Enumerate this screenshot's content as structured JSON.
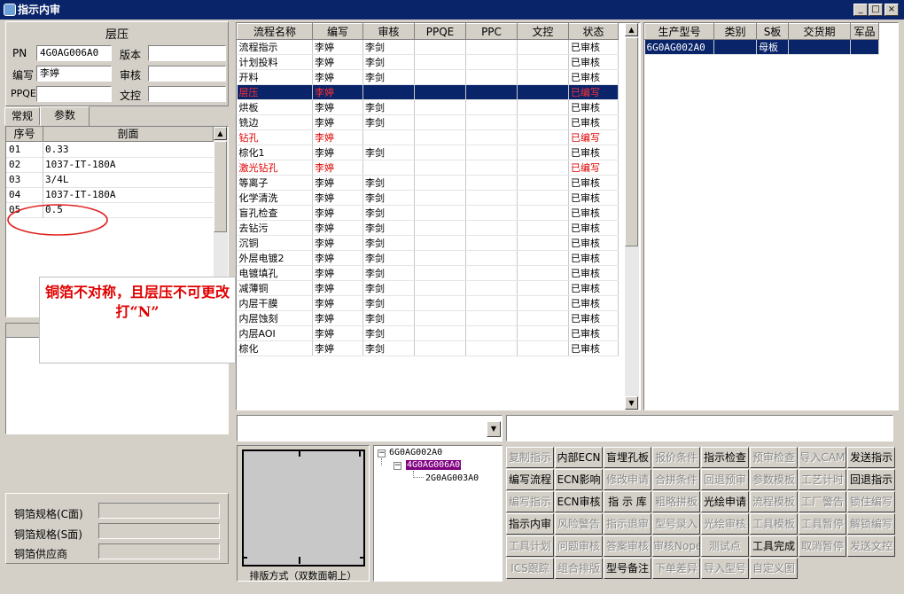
{
  "window": {
    "title": "指示内审",
    "min": "_",
    "max": "□",
    "close": "×"
  },
  "left": {
    "section_title": "层压",
    "pn_label": "PN",
    "pn_value": "4G0AG006A0",
    "version_label": "版本",
    "version_value": "",
    "writer_label": "编写",
    "writer_value": "李婷",
    "review_label": "审核",
    "review_value": "",
    "ppqe_label": "PPQE",
    "ppqe_value": "",
    "doc_label": "文控",
    "doc_value": "",
    "tabs": [
      "常规",
      "参数"
    ],
    "param_headers": [
      "序号",
      "剖面"
    ],
    "params": [
      {
        "no": "01",
        "val": "0.33"
      },
      {
        "no": "02",
        "val": "1037-IT-180A"
      },
      {
        "no": "03",
        "val": "3/4L"
      },
      {
        "no": "04",
        "val": "1037-IT-180A"
      },
      {
        "no": "05",
        "val": "0.5"
      }
    ],
    "annotation": "铜箔不对称，且层压不可更改打“N”",
    "copper_c_label": "铜箔规格(C面)",
    "copper_c_value": "",
    "copper_s_label": "铜箔规格(S面)",
    "copper_s_value": "",
    "copper_vendor_label": "铜箔供应商",
    "copper_vendor_value": ""
  },
  "process": {
    "headers": [
      "流程名称",
      "编写",
      "审核",
      "PPQE",
      "PPC",
      "文控",
      "状态"
    ],
    "rows": [
      {
        "name": "流程指示",
        "writer": "李婷",
        "reviewer": "李剑",
        "ppqe": "",
        "ppc": "",
        "doc": "",
        "status": "已审核",
        "style": ""
      },
      {
        "name": "计划投料",
        "writer": "李婷",
        "reviewer": "李剑",
        "ppqe": "",
        "ppc": "",
        "doc": "",
        "status": "已审核",
        "style": ""
      },
      {
        "name": "开料",
        "writer": "李婷",
        "reviewer": "李剑",
        "ppqe": "",
        "ppc": "",
        "doc": "",
        "status": "已审核",
        "style": ""
      },
      {
        "name": "层压",
        "writer": "李婷",
        "reviewer": "",
        "ppqe": "",
        "ppc": "",
        "doc": "",
        "status": "已编写",
        "style": "sel"
      },
      {
        "name": "烘板",
        "writer": "李婷",
        "reviewer": "李剑",
        "ppqe": "",
        "ppc": "",
        "doc": "",
        "status": "已审核",
        "style": ""
      },
      {
        "name": "铣边",
        "writer": "李婷",
        "reviewer": "李剑",
        "ppqe": "",
        "ppc": "",
        "doc": "",
        "status": "已审核",
        "style": ""
      },
      {
        "name": "钻孔",
        "writer": "李婷",
        "reviewer": "",
        "ppqe": "",
        "ppc": "",
        "doc": "",
        "status": "已编写",
        "style": "red"
      },
      {
        "name": "棕化1",
        "writer": "李婷",
        "reviewer": "李剑",
        "ppqe": "",
        "ppc": "",
        "doc": "",
        "status": "已审核",
        "style": ""
      },
      {
        "name": "激光钻孔",
        "writer": "李婷",
        "reviewer": "",
        "ppqe": "",
        "ppc": "",
        "doc": "",
        "status": "已编写",
        "style": "red"
      },
      {
        "name": "等离子",
        "writer": "李婷",
        "reviewer": "李剑",
        "ppqe": "",
        "ppc": "",
        "doc": "",
        "status": "已审核",
        "style": ""
      },
      {
        "name": "化学清洗",
        "writer": "李婷",
        "reviewer": "李剑",
        "ppqe": "",
        "ppc": "",
        "doc": "",
        "status": "已审核",
        "style": ""
      },
      {
        "name": "盲孔检查",
        "writer": "李婷",
        "reviewer": "李剑",
        "ppqe": "",
        "ppc": "",
        "doc": "",
        "status": "已审核",
        "style": ""
      },
      {
        "name": "去钻污",
        "writer": "李婷",
        "reviewer": "李剑",
        "ppqe": "",
        "ppc": "",
        "doc": "",
        "status": "已审核",
        "style": ""
      },
      {
        "name": "沉铜",
        "writer": "李婷",
        "reviewer": "李剑",
        "ppqe": "",
        "ppc": "",
        "doc": "",
        "status": "已审核",
        "style": ""
      },
      {
        "name": "外层电镀2",
        "writer": "李婷",
        "reviewer": "李剑",
        "ppqe": "",
        "ppc": "",
        "doc": "",
        "status": "已审核",
        "style": ""
      },
      {
        "name": "电镀填孔",
        "writer": "李婷",
        "reviewer": "李剑",
        "ppqe": "",
        "ppc": "",
        "doc": "",
        "status": "已审核",
        "style": ""
      },
      {
        "name": "减薄铜",
        "writer": "李婷",
        "reviewer": "李剑",
        "ppqe": "",
        "ppc": "",
        "doc": "",
        "status": "已审核",
        "style": ""
      },
      {
        "name": "内层干膜",
        "writer": "李婷",
        "reviewer": "李剑",
        "ppqe": "",
        "ppc": "",
        "doc": "",
        "status": "已审核",
        "style": ""
      },
      {
        "name": "内层蚀刻",
        "writer": "李婷",
        "reviewer": "李剑",
        "ppqe": "",
        "ppc": "",
        "doc": "",
        "status": "已审核",
        "style": ""
      },
      {
        "name": "内层AOI",
        "writer": "李婷",
        "reviewer": "李剑",
        "ppqe": "",
        "ppc": "",
        "doc": "",
        "status": "已审核",
        "style": ""
      },
      {
        "name": "棕化",
        "writer": "李婷",
        "reviewer": "李剑",
        "ppqe": "",
        "ppc": "",
        "doc": "",
        "status": "已审核",
        "style": ""
      }
    ]
  },
  "product": {
    "headers": [
      "生产型号",
      "类别",
      "S板",
      "交货期",
      "军品"
    ],
    "rows": [
      {
        "model": "6G0AG002A0",
        "cat": "",
        "sboard": "母板",
        "due": "",
        "mil": ""
      }
    ]
  },
  "combo_value": "",
  "preview_caption": "排版方式（双数面朝上）",
  "tree": {
    "root": "6G0AG002A0",
    "child": "4G0AG006A0",
    "leaf": "2G0AG003A0"
  },
  "buttons": [
    [
      {
        "t": "复制指示",
        "e": false
      },
      {
        "t": "内部ECN",
        "e": true
      },
      {
        "t": "盲埋孔板",
        "e": true
      },
      {
        "t": "报价条件",
        "e": false
      },
      {
        "t": "指示检查",
        "e": true
      },
      {
        "t": "预审检查",
        "e": false
      },
      {
        "t": "导入CAM",
        "e": false
      },
      {
        "t": "发送指示",
        "e": true
      }
    ],
    [
      {
        "t": "编写流程",
        "e": true
      },
      {
        "t": "ECN影响",
        "e": true
      },
      {
        "t": "修改申请",
        "e": false
      },
      {
        "t": "合拼条件",
        "e": false
      },
      {
        "t": "回退预审",
        "e": false
      },
      {
        "t": "参数模板",
        "e": false
      },
      {
        "t": "工艺计时",
        "e": false
      },
      {
        "t": "回退指示",
        "e": true
      }
    ],
    [
      {
        "t": "编写指示",
        "e": false
      },
      {
        "t": "ECN审核",
        "e": true
      },
      {
        "t": "指 示 库",
        "e": true
      },
      {
        "t": "粗略拼板",
        "e": false
      },
      {
        "t": "光绘申请",
        "e": true
      },
      {
        "t": "流程模板",
        "e": false
      },
      {
        "t": "工厂警告",
        "e": false
      },
      {
        "t": "锁住编写",
        "e": false
      }
    ],
    [
      {
        "t": "指示内审",
        "e": true
      },
      {
        "t": "风险警告",
        "e": false
      },
      {
        "t": "指示退审",
        "e": false
      },
      {
        "t": "型号录入",
        "e": false
      },
      {
        "t": "光绘审核",
        "e": false
      },
      {
        "t": "工具模板",
        "e": false
      },
      {
        "t": "工具暂停",
        "e": false
      },
      {
        "t": "解锁编写",
        "e": false
      }
    ],
    [
      {
        "t": "工具计划",
        "e": false
      },
      {
        "t": "问题审核",
        "e": false
      },
      {
        "t": "答案审核",
        "e": false
      },
      {
        "t": "审核Nope",
        "e": false
      },
      {
        "t": "测试点",
        "e": false
      },
      {
        "t": "工具完成",
        "e": true
      },
      {
        "t": "取消暂停",
        "e": false
      },
      {
        "t": "发送文控",
        "e": false
      }
    ],
    [
      {
        "t": "ICS跟踪",
        "e": false
      },
      {
        "t": "组合排版",
        "e": false
      },
      {
        "t": "型号备注",
        "e": true
      },
      {
        "t": "下单差异",
        "e": false
      },
      {
        "t": "导入型号",
        "e": false
      },
      {
        "t": "自定义图",
        "e": false
      }
    ]
  ]
}
